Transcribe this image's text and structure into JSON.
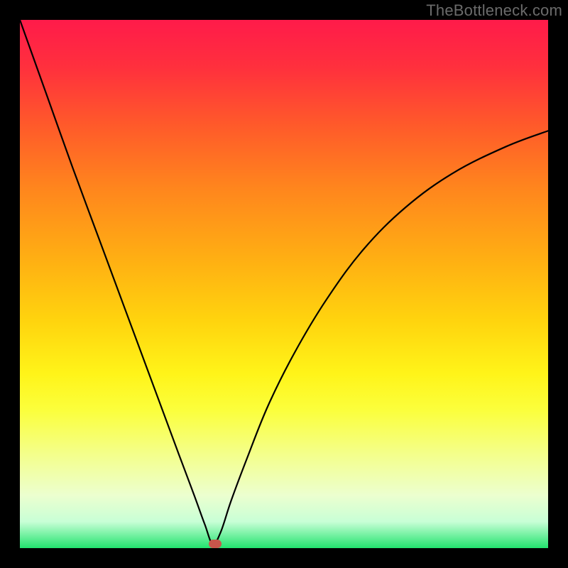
{
  "watermark": "TheBottleneck.com",
  "chart_data": {
    "type": "line",
    "title": "",
    "xlabel": "",
    "ylabel": "",
    "xlim": [
      0,
      100
    ],
    "ylim": [
      0,
      100
    ],
    "grid": false,
    "legend": false,
    "series": [
      {
        "name": "bottleneck-curve",
        "x": [
          0,
          5,
          10,
          15,
          20,
          25,
          30,
          33,
          35,
          36.5,
          38,
          40,
          43,
          47,
          52,
          58,
          65,
          73,
          82,
          92,
          100
        ],
        "y": [
          100,
          86,
          72,
          58.5,
          45,
          31.5,
          18,
          10,
          4.5,
          0.8,
          3,
          9,
          17,
          27,
          37,
          47,
          56.5,
          64.5,
          71,
          76,
          79
        ]
      }
    ],
    "marker": {
      "x": 37,
      "y": 0.8
    },
    "background_gradient": {
      "top": "#ff1b4a",
      "mid": "#fff419",
      "bottom": "#22e36e"
    }
  }
}
